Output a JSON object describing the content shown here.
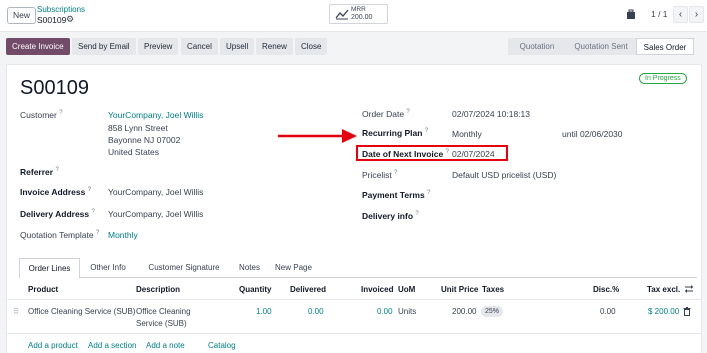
{
  "header": {
    "new_label": "New",
    "breadcrumb_parent": "Subscriptions",
    "breadcrumb_current": "S00109",
    "mrr_label": "MRR",
    "mrr_value": "200.00",
    "pager": "1 / 1"
  },
  "actions": {
    "create_invoice": "Create Invoice",
    "send_by_email": "Send by Email",
    "preview": "Preview",
    "cancel": "Cancel",
    "upsell": "Upsell",
    "renew": "Renew",
    "close": "Close"
  },
  "stages": [
    "Quotation",
    "Quotation Sent",
    "Sales Order"
  ],
  "record": {
    "name": "S00109",
    "status": "In Progress",
    "customer_label": "Customer",
    "customer_name": "YourCompany, Joel Willis",
    "customer_street": "858 Lynn Street",
    "customer_city": "Bayonne NJ 07002",
    "customer_country": "United States",
    "referrer_label": "Referrer",
    "invoice_address_label": "Invoice Address",
    "invoice_address": "YourCompany, Joel Willis",
    "delivery_address_label": "Delivery Address",
    "delivery_address": "YourCompany, Joel Willis",
    "quotation_template_label": "Quotation Template",
    "quotation_template": "Monthly",
    "order_date_label": "Order Date",
    "order_date": "02/07/2024 10:18:13",
    "recurring_plan_label": "Recurring Plan",
    "recurring_plan": "Monthly",
    "recurring_until": "until 02/06/2030",
    "next_invoice_label": "Date of Next Invoice",
    "next_invoice": "02/07/2024",
    "pricelist_label": "Pricelist",
    "pricelist": "Default USD pricelist (USD)",
    "payment_terms_label": "Payment Terms",
    "delivery_info_label": "Delivery info",
    "help_mark": "?"
  },
  "tabs": [
    "Order Lines",
    "Other Info",
    "Customer Signature",
    "Notes",
    "New Page"
  ],
  "table": {
    "headers": [
      "Product",
      "Description",
      "Quantity",
      "Delivered",
      "Invoiced",
      "UoM",
      "Unit Price",
      "Taxes",
      "Disc.%",
      "Tax excl."
    ],
    "rows": [
      {
        "product": "Office Cleaning Service (SUB)",
        "description_line1": "Office Cleaning",
        "description_line2": "Service (SUB)",
        "quantity": "1.00",
        "delivered": "0.00",
        "invoiced": "0.00",
        "uom": "Units",
        "unit_price": "200.00",
        "taxes": "25%",
        "discount": "0.00",
        "subtotal": "$ 200.00"
      }
    ],
    "add_links": [
      "Add a product",
      "Add a section",
      "Add a note",
      "Catalog"
    ]
  },
  "colors": {
    "primary": "#714b67",
    "link": "#017e84",
    "badge": "#28a745",
    "annotation": "#e3000f"
  }
}
